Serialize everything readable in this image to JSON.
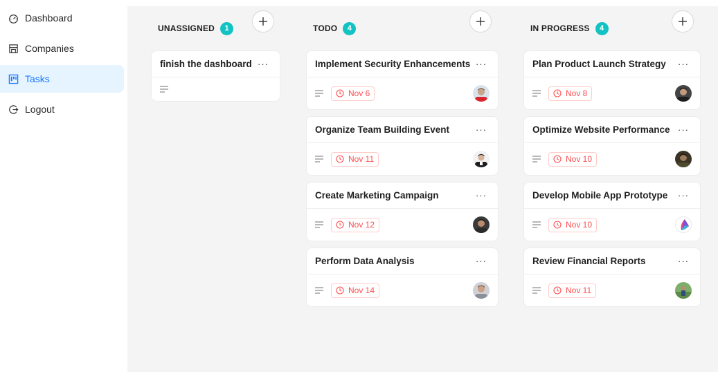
{
  "sidebar": {
    "items": [
      {
        "label": "Dashboard",
        "icon": "dashboard-icon"
      },
      {
        "label": "Companies",
        "icon": "shop-icon"
      },
      {
        "label": "Tasks",
        "icon": "project-board-icon",
        "active": true
      },
      {
        "label": "Logout",
        "icon": "logout-icon"
      }
    ]
  },
  "columns": {
    "unassigned": {
      "title": "UNASSIGNED",
      "count": "1"
    },
    "todo": {
      "title": "TODO",
      "count": "4"
    },
    "in_progress": {
      "title": "IN PROGRESS",
      "count": "4"
    }
  },
  "cards": {
    "unassigned": [
      {
        "title": "finish the dashboard"
      }
    ],
    "todo": [
      {
        "title": "Implement Security Enhancements",
        "due": "Nov 6"
      },
      {
        "title": "Organize Team Building Event",
        "due": "Nov 11"
      },
      {
        "title": "Create Marketing Campaign",
        "due": "Nov 12"
      },
      {
        "title": "Perform Data Analysis",
        "due": "Nov 14"
      }
    ],
    "in_progress": [
      {
        "title": "Plan Product Launch Strategy",
        "due": "Nov 8"
      },
      {
        "title": "Optimize Website Performance",
        "due": "Nov 10"
      },
      {
        "title": "Develop Mobile App Prototype",
        "due": "Nov 10"
      },
      {
        "title": "Review Financial Reports",
        "due": "Nov 11"
      }
    ]
  },
  "colors": {
    "accent": "#1677ff",
    "active_bg": "#e6f4ff",
    "count_badge": "#13c2c2",
    "due_red": "#ff4d4f",
    "board_bg": "#f4f4f4"
  }
}
